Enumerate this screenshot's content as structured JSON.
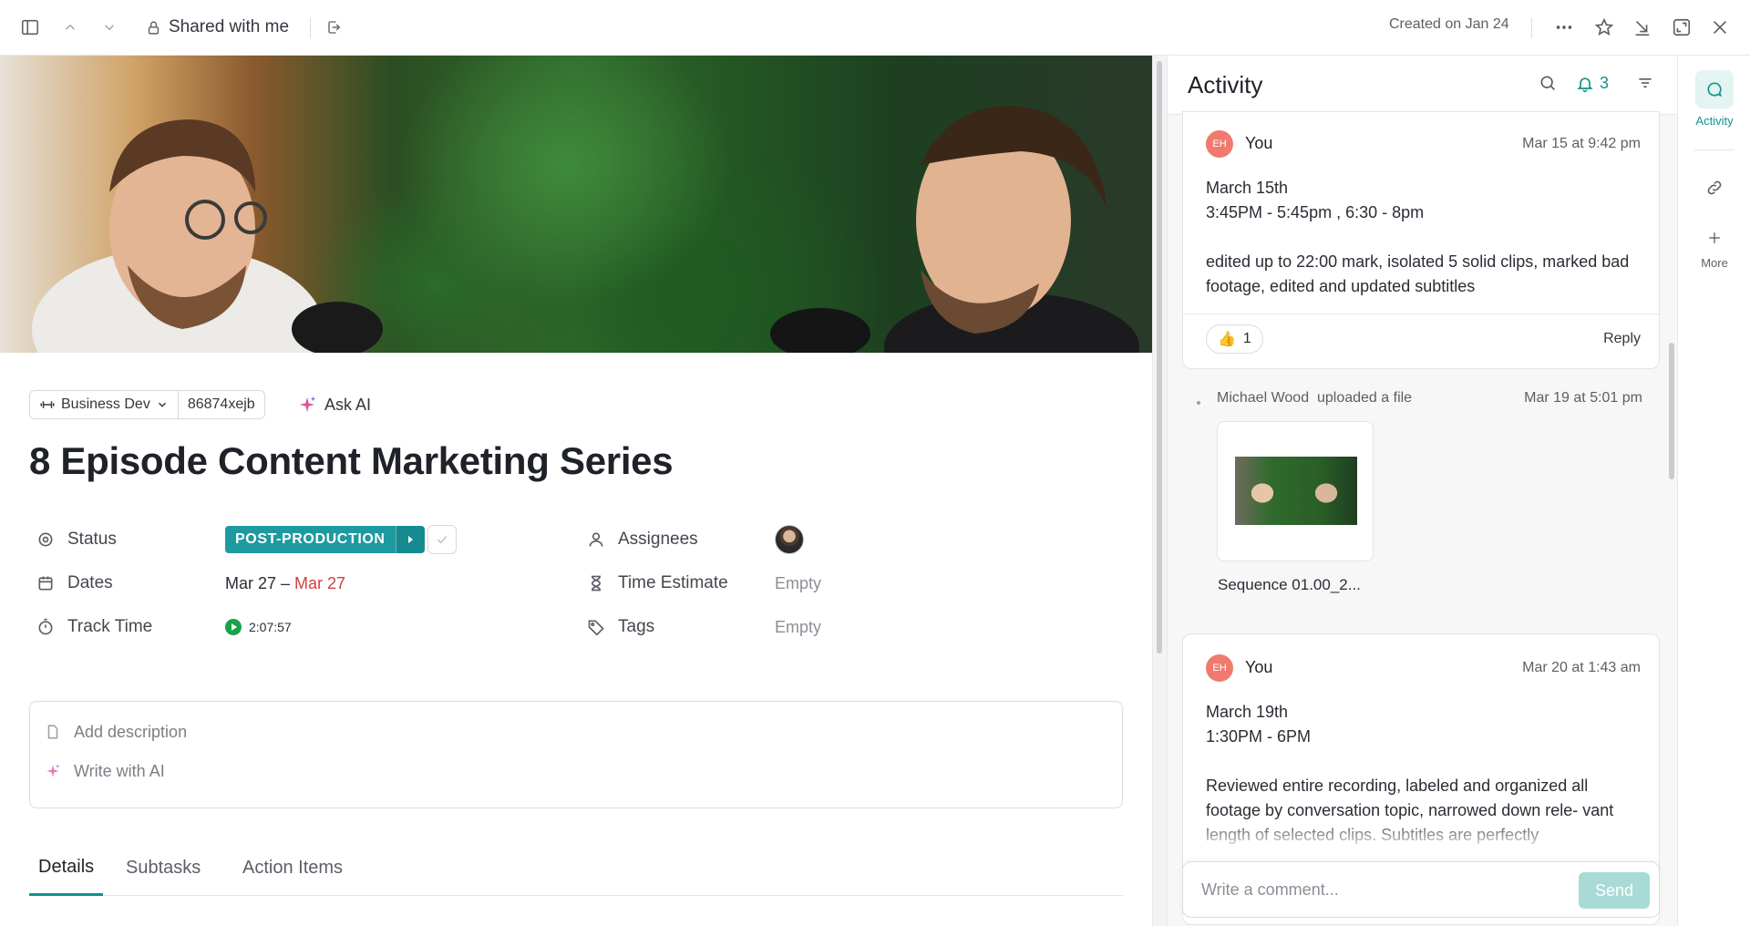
{
  "topbar": {
    "breadcrumb": "Shared with me",
    "created": "Created on Jan 24",
    "icons": [
      "sidebar-toggle-icon",
      "chevron-up-icon",
      "chevron-down-icon",
      "lock-icon",
      "move-icon",
      "more-icon",
      "star-icon",
      "minimize-icon",
      "expand-icon",
      "close-icon"
    ]
  },
  "task": {
    "space": "Business Dev",
    "task_id": "86874xejb",
    "ask_ai": "Ask AI",
    "title": "8 Episode Content Marketing Series",
    "fields": {
      "status_label": "Status",
      "status_value": "POST-PRODUCTION",
      "dates_label": "Dates",
      "date_start": "Mar 27",
      "date_sep": " – ",
      "date_end": "Mar 27",
      "track_label": "Track Time",
      "track_value": "2:07:57",
      "assignees_label": "Assignees",
      "estimate_label": "Time Estimate",
      "estimate_value": "Empty",
      "tags_label": "Tags",
      "tags_value": "Empty"
    },
    "description": {
      "add": "Add description",
      "ai": "Write with AI"
    },
    "tabs": [
      "Details",
      "Subtasks",
      "Action Items"
    ],
    "active_tab": "Details"
  },
  "activity": {
    "title": "Activity",
    "notification_count": "3",
    "entries": [
      {
        "avatar": "EH",
        "author": "You",
        "time": "Mar 15 at 9:42 pm",
        "line1": "March 15th",
        "line2": "3:45PM - 5:45pm , 6:30 - 8pm",
        "line3": "edited up to 22:00 mark, isolated 5 solid clips, marked bad footage, edited and updated subtitles",
        "reaction_emoji": "👍",
        "reaction_count": "1",
        "reply": "Reply"
      },
      {
        "author": "Michael Wood",
        "action": "uploaded a file",
        "time": "Mar 19 at 5:01 pm",
        "filename": "Sequence 01.00_2..."
      },
      {
        "avatar": "EH",
        "author": "You",
        "time": "Mar 20 at 1:43 am",
        "line1": "March 19th",
        "line2": "1:30PM - 6PM",
        "line3": "Reviewed entire recording, labeled and organized all footage by conversation topic, narrowed down rele- vant length of selected clips. Subtitles are perfectly"
      }
    ],
    "comment_placeholder": "Write a comment...",
    "send": "Send"
  },
  "rail": {
    "items": [
      {
        "label": "Activity"
      },
      {
        "label": ""
      },
      {
        "label": "More"
      }
    ]
  },
  "colors": {
    "accent": "#13928b",
    "status": "#1d9aa0",
    "avatar": "#f07a6e",
    "due_date": "#d33d3d"
  }
}
